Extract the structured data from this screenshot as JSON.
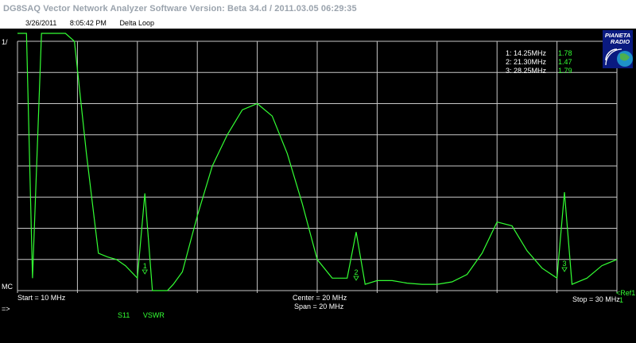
{
  "window": {
    "title": "DG8SAQ Vector Network Analyzer Software   Version:  Beta 34.d / 2011.03.05 06:29:35"
  },
  "info": {
    "date": "3/26/2011",
    "time": "8:05:42 PM",
    "description": "Delta Loop"
  },
  "axis": {
    "left_top_label": "1/",
    "left_bottom_label": "MC",
    "start": "Start = 10 MHz",
    "center": "Center = 20 MHz",
    "span": "Span = 20 MHz",
    "stop": "Stop = 30 MHz",
    "ref_label": "<Ref1",
    "ref_sub": "1"
  },
  "markers": [
    {
      "label": "1:  14.25MHz",
      "value": "1.78"
    },
    {
      "label": "2:  21.30MHz",
      "value": "1.47"
    },
    {
      "label": "3:  28.25MHz",
      "value": "1.79"
    }
  ],
  "marker_tags": [
    "1",
    "2",
    "3"
  ],
  "logo": {
    "line1": "PIANETA",
    "line2": "RADIO"
  },
  "bottom": {
    "arrow": "=>"
  },
  "trace": {
    "param": "S11",
    "format": "VSWR"
  },
  "colors": {
    "trace": "#33ff33",
    "grid": "#c8c8c8",
    "background": "#000000"
  },
  "chart_data": {
    "type": "line",
    "x_unit": "MHz",
    "xlim": [
      10,
      30
    ],
    "ylim": [
      1,
      3
    ],
    "y_scale_note": "1/ top, MC bottom",
    "x": [
      10.0,
      10.3,
      10.5,
      10.8,
      11.0,
      11.3,
      11.6,
      11.9,
      12.3,
      12.7,
      13.0,
      13.3,
      13.6,
      14.0,
      14.25,
      14.5,
      14.8,
      15.0,
      15.2,
      15.5,
      16.0,
      16.5,
      17.0,
      17.5,
      18.0,
      18.5,
      19.0,
      19.5,
      20.0,
      20.5,
      21.0,
      21.3,
      21.6,
      22.0,
      22.5,
      23.0,
      23.5,
      24.0,
      24.5,
      25.0,
      25.5,
      26.0,
      26.5,
      27.0,
      27.5,
      28.0,
      28.25,
      28.5,
      29.0,
      29.5,
      30.0
    ],
    "y": [
      3.2,
      3.4,
      1.1,
      3.6,
      3.5,
      3.4,
      3.4,
      3.0,
      2.1,
      1.3,
      1.27,
      1.25,
      1.2,
      1.1,
      1.78,
      1.0,
      1.0,
      1.0,
      1.05,
      1.15,
      1.6,
      2.0,
      2.25,
      2.45,
      2.5,
      2.4,
      2.1,
      1.7,
      1.25,
      1.1,
      1.1,
      1.47,
      1.05,
      1.08,
      1.08,
      1.06,
      1.05,
      1.05,
      1.07,
      1.13,
      1.3,
      1.55,
      1.52,
      1.32,
      1.18,
      1.1,
      1.79,
      1.05,
      1.1,
      1.2,
      1.25
    ]
  }
}
